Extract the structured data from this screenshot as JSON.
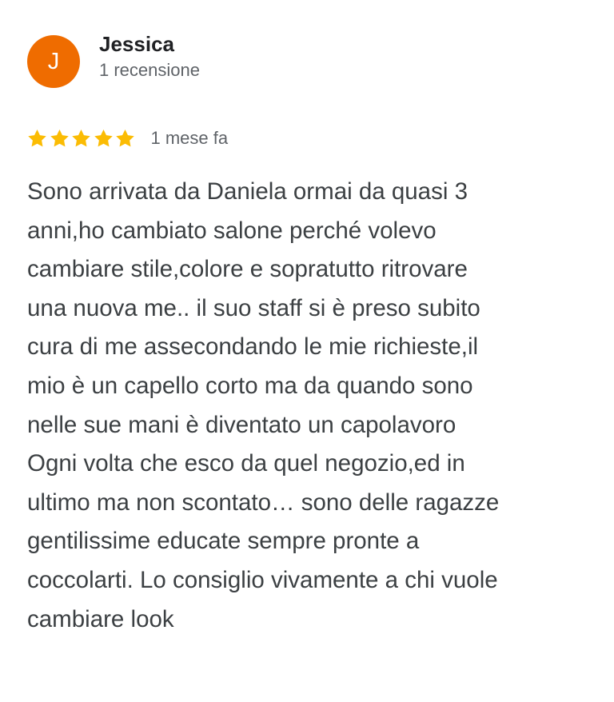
{
  "reviewer": {
    "initial": "J",
    "name": "Jessica",
    "meta": "1 recensione",
    "avatar_color": "#ef6c00"
  },
  "rating": {
    "stars": 5,
    "max_stars": 5,
    "star_color": "#fbbc04",
    "date": "1 mese fa"
  },
  "review": {
    "lines": [
      "Sono arrivata da Daniela ormai da quasi 3",
      "anni,ho cambiato salone perché volevo",
      "cambiare stile,colore e sopratutto ritrovare",
      "una nuova me.. il suo staff si è preso subito",
      "cura di me assecondando le mie richieste,il",
      "mio è un capello corto ma da quando sono",
      "nelle sue mani è diventato un capolavoro",
      "Ogni volta che esco da quel negozio,ed in",
      "ultimo ma non scontato… sono delle ragazze",
      "gentilissime educate sempre pronte a",
      "coccolarti. Lo consiglio vivamente a chi vuole",
      "cambiare look"
    ]
  }
}
